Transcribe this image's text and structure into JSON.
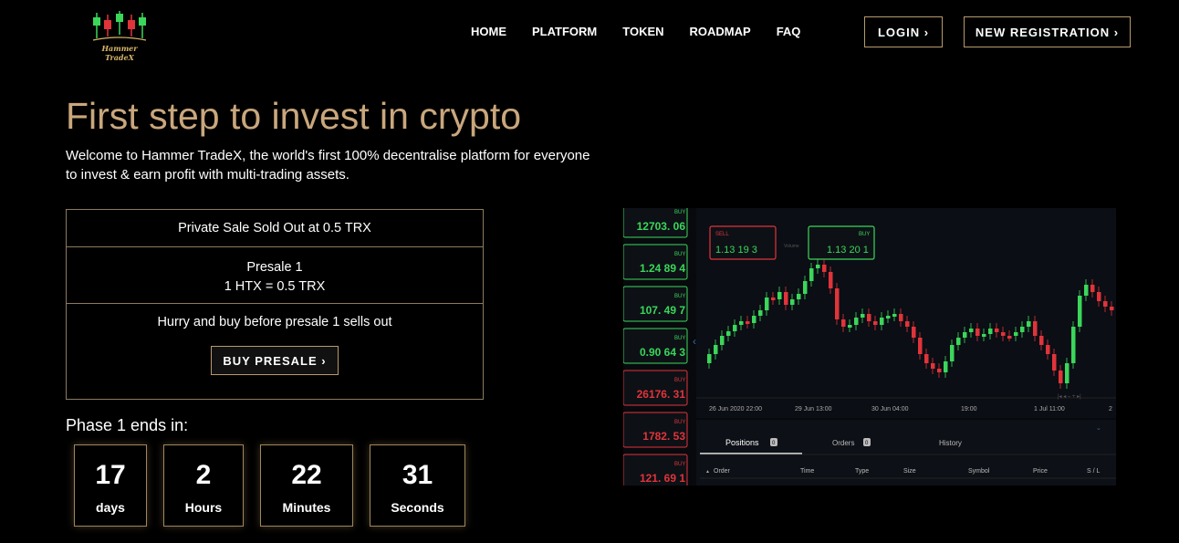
{
  "brand": {
    "name": "Hammer TradeX"
  },
  "nav": [
    "HOME",
    "PLATFORM",
    "TOKEN",
    "ROADMAP",
    "FAQ"
  ],
  "header": {
    "login": "LOGIN ›",
    "register": "NEW REGISTRATION ›"
  },
  "hero": {
    "title": "First step to invest in crypto",
    "description": "Welcome to Hammer TradeX, the world's first 100% decentralise platform for everyone to invest & earn profit with multi-trading assets."
  },
  "sale": {
    "private": "Private Sale Sold Out at 0.5 TRX",
    "presale_title": "Presale 1",
    "presale_rate": "1 HTX = 0.5 TRX",
    "hurry": "Hurry and buy before presale 1 sells out",
    "buy_button": "BUY PRESALE ›"
  },
  "countdown": {
    "heading": "Phase 1 ends in:",
    "units": [
      {
        "value": "17",
        "label": "days"
      },
      {
        "value": "2",
        "label": "Hours"
      },
      {
        "value": "22",
        "label": "Minutes"
      },
      {
        "value": "31",
        "label": "Seconds"
      }
    ]
  },
  "trading": {
    "side_quotes": [
      {
        "tag": "BUY",
        "price": "12703. 06",
        "color": "#3bd65a"
      },
      {
        "tag": "BUY",
        "price": "1.24 89 4",
        "color": "#3bd65a"
      },
      {
        "tag": "BUY",
        "price": "107. 49 7",
        "color": "#3bd65a"
      },
      {
        "tag": "BUY",
        "price": "0.90 64 3",
        "color": "#3bd65a"
      },
      {
        "tag": "BUY",
        "price": "26176. 31",
        "color": "#e0343a"
      },
      {
        "tag": "BUY",
        "price": "1782. 53",
        "color": "#e0343a"
      },
      {
        "tag": "BUY",
        "price": "121. 69 1",
        "color": "#e0343a"
      }
    ],
    "sell_box": {
      "tag": "SELL",
      "price": "1.13 19 3"
    },
    "volume": "Volume",
    "buy_box": {
      "tag": "BUY",
      "price": "1.13 20 1"
    },
    "time_labels": [
      "26 Jun 2020 22:00",
      "29 Jun 13:00",
      "30 Jun 04:00",
      "19:00",
      "1 Jul 11:00",
      "2"
    ],
    "tabs": [
      {
        "label": "Positions",
        "count": "0"
      },
      {
        "label": "Orders",
        "count": "0"
      },
      {
        "label": "History"
      }
    ],
    "columns": [
      "Order",
      "Time",
      "Type",
      "Size",
      "Symbol",
      "Price",
      "S / L"
    ],
    "colors": {
      "up": "#3bd65a",
      "down": "#e0343a"
    }
  }
}
